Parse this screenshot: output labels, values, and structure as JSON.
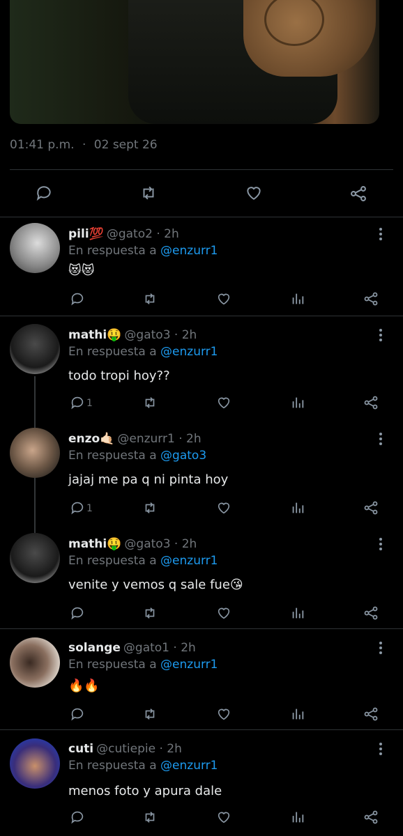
{
  "tweet": {
    "time": "01:41 p.m.",
    "sep": "·",
    "date": "02 sept 26"
  },
  "actions": {
    "reply": "reply-icon",
    "retweet": "retweet-icon",
    "like": "heart-icon",
    "share": "share-icon"
  },
  "replies": [
    {
      "name": "pili💯",
      "handle": "@gato2 · 2h",
      "in_reply_prefix": "En respuesta a",
      "mention": "@enzurr1",
      "text": "😻😻",
      "reply_count": ""
    },
    {
      "name": "mathi🤑",
      "handle": "@gato3 · 2h",
      "in_reply_prefix": "En respuesta a",
      "mention": "@enzurr1",
      "text": "todo tropi hoy??",
      "reply_count": "1"
    },
    {
      "name": "enzo🤙🏻",
      "handle": "@enzurr1 · 2h",
      "in_reply_prefix": "En respuesta a",
      "mention": "@gato3",
      "text": "jajaj me pa q ni pinta hoy",
      "reply_count": "1"
    },
    {
      "name": "mathi🤑",
      "handle": "@gato3 · 2h",
      "in_reply_prefix": "En respuesta a",
      "mention": "@enzurr1",
      "text": "venite y vemos q sale fue😘",
      "reply_count": ""
    },
    {
      "name": "solange",
      "handle": "@gato1 · 2h",
      "in_reply_prefix": "En respuesta a",
      "mention": "@enzurr1",
      "text": "🔥🔥",
      "reply_count": ""
    },
    {
      "name": "cuti",
      "handle": "@cutiepie · 2h",
      "in_reply_prefix": "En respuesta a",
      "mention": "@enzurr1",
      "text": "menos foto y apura dale",
      "reply_count": ""
    }
  ],
  "colors": {
    "background": "#000000",
    "text": "#e7e9ea",
    "muted": "#71767b",
    "link": "#1d9bf0",
    "divider": "#2f3336"
  }
}
